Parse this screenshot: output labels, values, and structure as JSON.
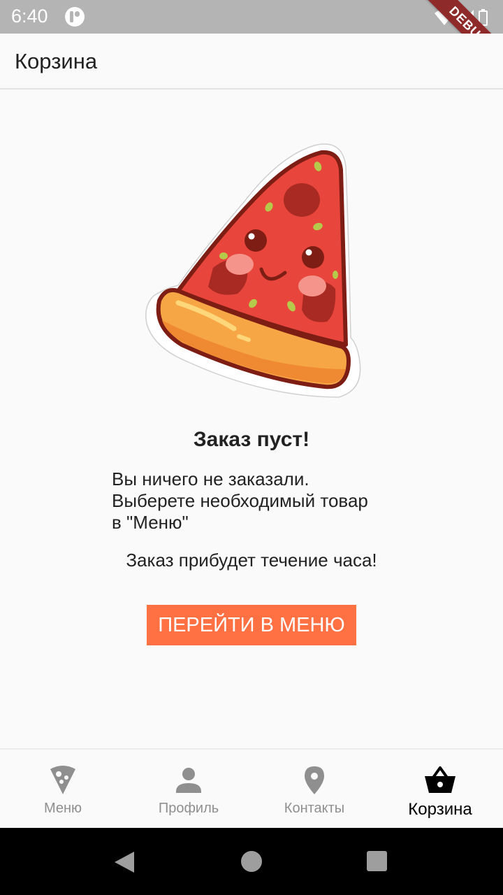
{
  "status_bar": {
    "time": "6:40",
    "debug_label": "DEBUG"
  },
  "app_bar": {
    "title": "Корзина"
  },
  "empty_state": {
    "title": "Заказ пуст!",
    "description": "Вы ничего не заказали.\nВыберете необходимый товар\nв \"Меню\"",
    "delivery_note": "Заказ прибудет течение часа!",
    "button_label": "ПЕРЕЙТИ В МЕНЮ"
  },
  "bottom_nav": {
    "items": [
      {
        "label": "Меню",
        "icon": "pizza-icon",
        "active": false
      },
      {
        "label": "Профиль",
        "icon": "person-icon",
        "active": false
      },
      {
        "label": "Контакты",
        "icon": "location-pin-icon",
        "active": false
      },
      {
        "label": "Корзина",
        "icon": "basket-icon",
        "active": true
      }
    ]
  },
  "colors": {
    "accent": "#ff7043",
    "inactive": "#8f8f8f",
    "active": "#000000"
  }
}
